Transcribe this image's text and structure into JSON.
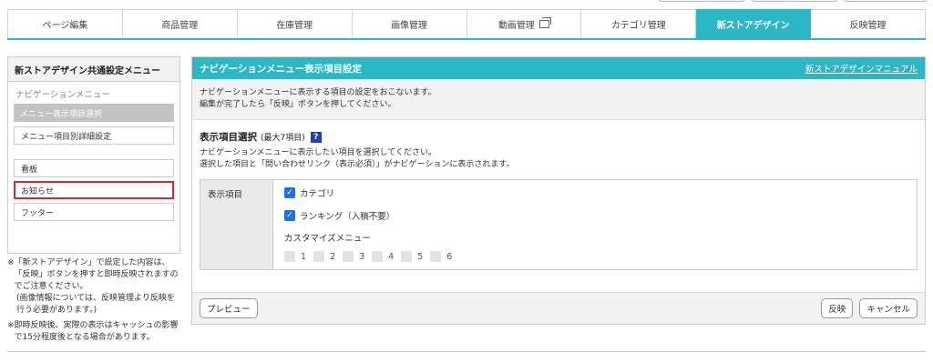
{
  "tabs": [
    {
      "label": "ページ編集",
      "active": false,
      "external": false
    },
    {
      "label": "商品管理",
      "active": false,
      "external": false
    },
    {
      "label": "在庫管理",
      "active": false,
      "external": false
    },
    {
      "label": "画像管理",
      "active": false,
      "external": false
    },
    {
      "label": "動画管理",
      "active": false,
      "external": true
    },
    {
      "label": "カテゴリ管理",
      "active": false,
      "external": false
    },
    {
      "label": "新ストアデザイン",
      "active": true,
      "external": false
    },
    {
      "label": "反映管理",
      "active": false,
      "external": false
    }
  ],
  "sidebar": {
    "title": "新ストアデザイン共通設定メニュー",
    "group_label": "ナビゲーションメニュー",
    "selected_item": "メニュー表示項目選択",
    "items": [
      "メニュー項目別詳細設定",
      "看板",
      "お知らせ",
      "フッター"
    ],
    "notes": [
      {
        "mark": "※",
        "text": "「新ストアデザイン」で設定した内容は、「反映」ボタンを押すと即時反映されますのでご注意ください。"
      },
      {
        "mark": "",
        "text": "(画像情報については、反映管理より反映を行う必要があります。)"
      },
      {
        "mark": "※",
        "text": "即時反映後、実際の表示はキャッシュの影響で15分程度後となる場合があります。"
      }
    ]
  },
  "main": {
    "title": "ナビゲーションメニュー表示項目設定",
    "manual_link": "新ストアデザインマニュアル",
    "intro_lines": [
      "ナビゲーションメニューに表示する項目の設定をおこないます。",
      "編集が完了したら「反映」ボタンを押してください。"
    ],
    "section_title": "表示項目選択",
    "section_limit": "(最大7項目)",
    "help_icon": "?",
    "section_desc_lines": [
      "ナビゲーションメニューに表示したい項目を選択してください。",
      "選択した項目と「問い合わせリンク（表示必須）」がナビゲーションに表示されます。"
    ],
    "form_label": "表示項目",
    "checked_items": [
      "カテゴリ",
      "ランキング（入稿不要）"
    ],
    "custom_menu_label": "カスタマイズメニュー",
    "custom_numbers": [
      "1",
      "2",
      "3",
      "4",
      "5",
      "6"
    ],
    "preview_button": "プレビュー",
    "apply_button": "反映",
    "cancel_button": "キャンセル"
  },
  "colors": {
    "accent": "#2bb7c4",
    "checkbox": "#1c6ff0",
    "highlight_border": "#e0262b"
  }
}
